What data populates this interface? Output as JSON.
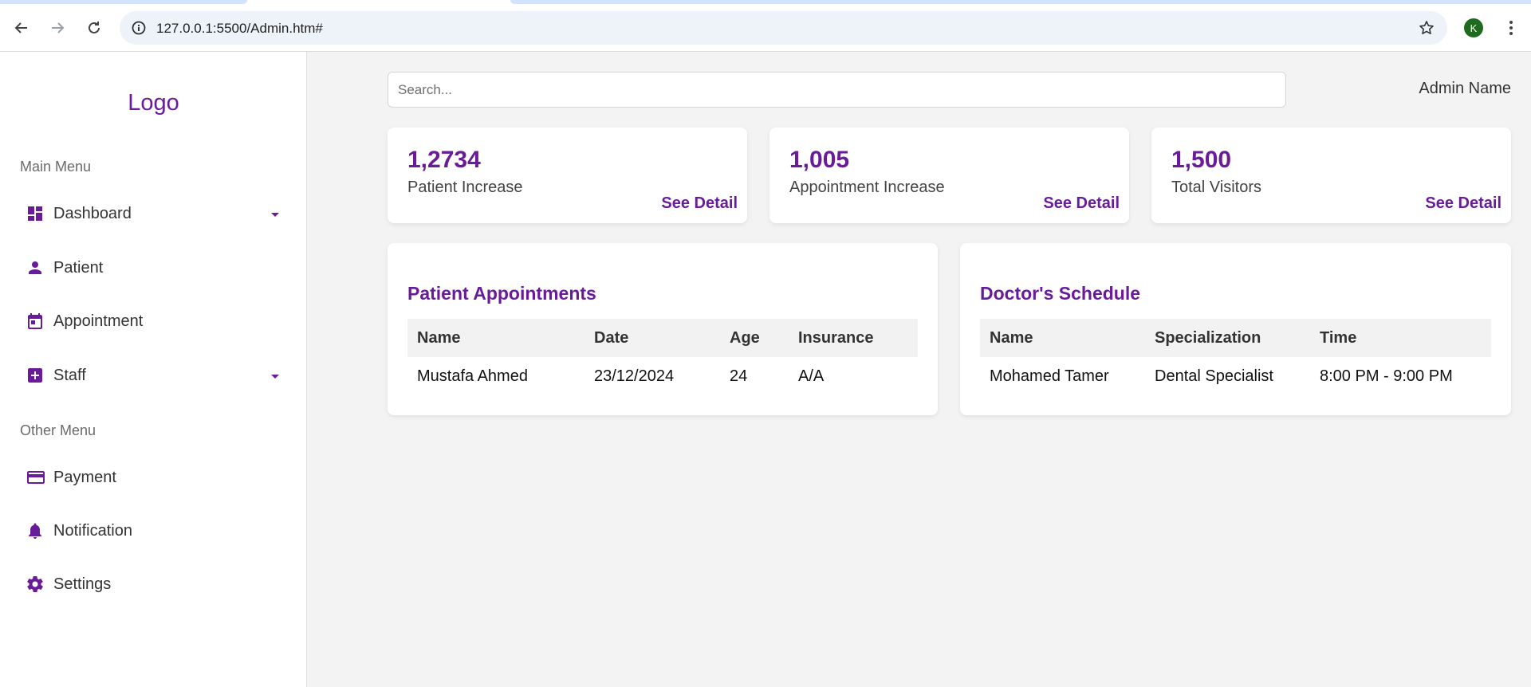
{
  "browser": {
    "url": "127.0.0.1:5500/Admin.htm#",
    "profile_initial": "K",
    "icons": [
      "back-arrow-icon",
      "forward-arrow-icon",
      "reload-icon",
      "site-info-icon",
      "bookmark-star-icon",
      "more-vert-icon"
    ]
  },
  "sidebar": {
    "logo": "Logo",
    "main_menu_heading": "Main Menu",
    "main_items": [
      {
        "label": "Dashboard",
        "icon": "dashboard-icon",
        "has_dropdown": true
      },
      {
        "label": "Patient",
        "icon": "person-icon",
        "has_dropdown": false
      },
      {
        "label": "Appointment",
        "icon": "calendar-icon",
        "has_dropdown": false
      },
      {
        "label": "Staff",
        "icon": "medical-cross-icon",
        "has_dropdown": true
      }
    ],
    "other_menu_heading": "Other Menu",
    "other_items": [
      {
        "label": "Payment",
        "icon": "credit-card-icon"
      },
      {
        "label": "Notification",
        "icon": "bell-icon"
      },
      {
        "label": "Settings",
        "icon": "gear-icon"
      }
    ]
  },
  "header": {
    "search_placeholder": "Search...",
    "admin_name": "Admin Name"
  },
  "stats": [
    {
      "value": "1,2734",
      "label": "Patient Increase",
      "link": "See Detail"
    },
    {
      "value": "1,005",
      "label": "Appointment Increase",
      "link": "See Detail"
    },
    {
      "value": "1,500",
      "label": "Total Visitors",
      "link": "See Detail"
    }
  ],
  "appointments": {
    "title": "Patient Appointments",
    "columns": [
      "Name",
      "Date",
      "Age",
      "Insurance"
    ],
    "rows": [
      [
        "Mustafa Ahmed",
        "23/12/2024",
        "24",
        "A/A"
      ]
    ]
  },
  "schedule": {
    "title": "Doctor's Schedule",
    "columns": [
      "Name",
      "Specialization",
      "Time"
    ],
    "rows": [
      [
        "Mohamed Tamer",
        "Dental Specialist",
        "8:00 PM - 9:00 PM"
      ]
    ]
  },
  "colors": {
    "accent": "#6a1b9a",
    "background": "#f3f3f3",
    "avatar": "#1e6a1e"
  }
}
